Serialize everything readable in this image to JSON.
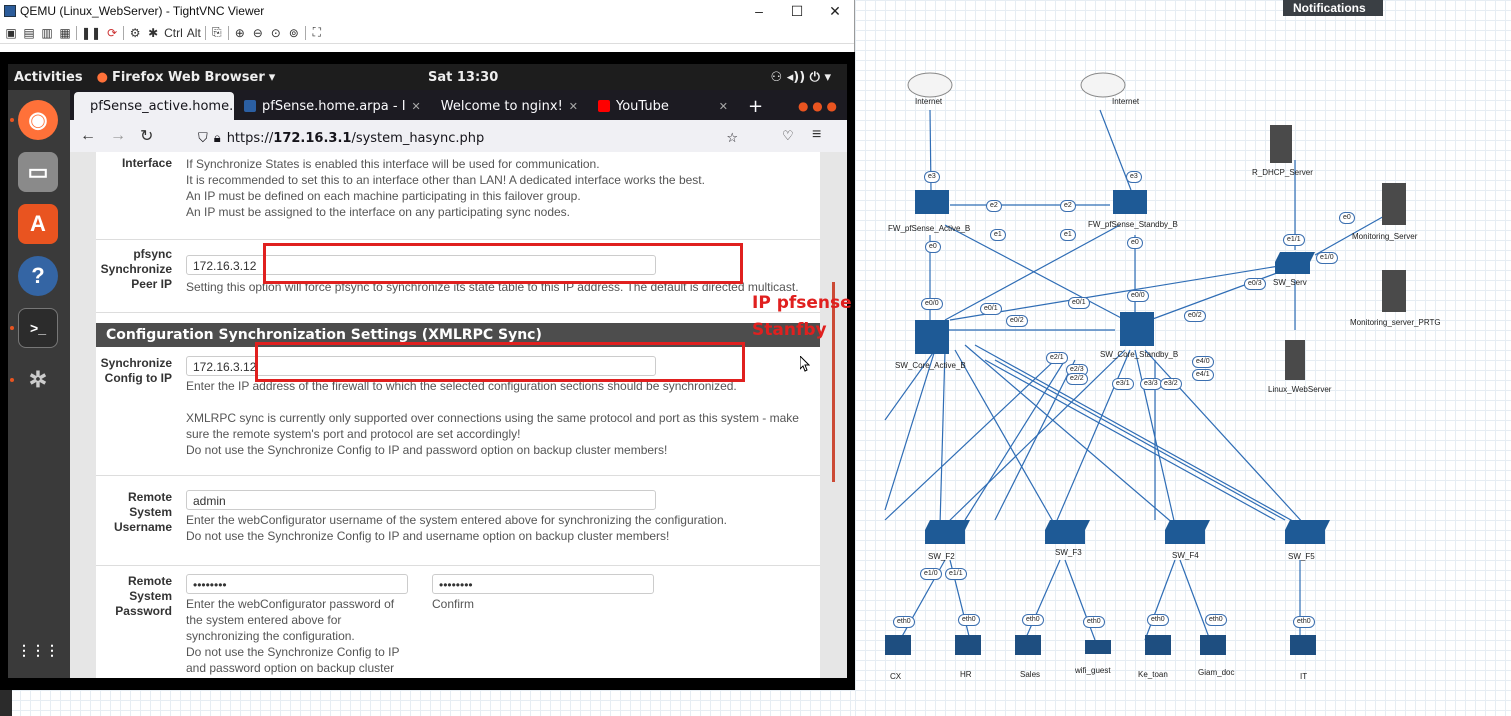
{
  "vnc": {
    "title": "QEMU (Linux_WebServer) - TightVNC Viewer",
    "toolbar": {
      "ctrl_label": "Ctrl",
      "alt_label": "Alt"
    }
  },
  "gnome": {
    "activities": "Activities",
    "app_name": "Firefox Web Browser",
    "clock": "Sat 13:30"
  },
  "firefox": {
    "tabs": [
      {
        "label": "pfSense_active.home.",
        "active": true
      },
      {
        "label": "pfSense.home.arpa - I",
        "active": false
      },
      {
        "label": "Welcome to nginx!",
        "active": false
      },
      {
        "label": "YouTube",
        "active": false
      }
    ],
    "url": {
      "scheme": "https://",
      "host": "172.16.3.1",
      "path": "/system_hasync.php"
    }
  },
  "pfsense": {
    "interface_label": "Interface",
    "interface_help": [
      "If Synchronize States is enabled this interface will be used for communication.",
      "It is recommended to set this to an interface other than LAN! A dedicated interface works the best.",
      "An IP must be defined on each machine participating in this failover group.",
      "An IP must be assigned to the interface on any participating sync nodes."
    ],
    "pfsync_label": "pfsync Synchronize Peer IP",
    "pfsync_value": "172.16.3.12",
    "pfsync_help": "Setting this option will force pfsync to synchronize its state table to this IP address. The default is directed multicast.",
    "section_title": "Configuration Synchronization Settings (XMLRPC Sync)",
    "sync_ip_label": "Synchronize Config to IP",
    "sync_ip_value": "172.16.3.12",
    "sync_ip_help1": "Enter the IP address of the firewall to which the selected configuration sections should be synchronized.",
    "sync_ip_help2": "XMLRPC sync is currently only supported over connections using the same protocol and port as this system - make sure the remote system's port and protocol are set accordingly!",
    "sync_ip_help3": "Do not use the Synchronize Config to IP and password option on backup cluster members!",
    "username_label": "Remote System Username",
    "username_value": "admin",
    "username_help1": "Enter the webConfigurator username of the system entered above for synchronizing the configuration.",
    "username_help2": "Do not use the Synchronize Config to IP and username option on backup cluster members!",
    "password_label": "Remote System Password",
    "password_value": "••••••••",
    "confirm_value": "••••••••",
    "password_help": "Enter the webConfigurator password of the system entered above for synchronizing the configuration.",
    "password_help2": "Do not use the Synchronize Config to IP and password option on backup cluster",
    "confirm_label": "Confirm"
  },
  "annotation": {
    "line1": "IP pfsense",
    "line2": "Stanfby"
  },
  "topology": {
    "notifications": "Notifications",
    "nodes": [
      {
        "id": "internet1",
        "label": "Internet"
      },
      {
        "id": "internet2",
        "label": "Internet"
      },
      {
        "id": "fw_active",
        "label": "FW_pfSense_Active_B"
      },
      {
        "id": "fw_standby",
        "label": "FW_pfSense_Standby_B"
      },
      {
        "id": "dhcp",
        "label": "R_DHCP_Server"
      },
      {
        "id": "monitoring",
        "label": "Monitoring_Server"
      },
      {
        "id": "sw_serv",
        "label": "SW_Serv"
      },
      {
        "id": "prtg",
        "label": "Monitoring_server_PRTG"
      },
      {
        "id": "core_active",
        "label": "SW_Core_Active_B"
      },
      {
        "id": "core_standby",
        "label": "SW_Core_Standby_B"
      },
      {
        "id": "linux_web",
        "label": "Linux_WebServer"
      },
      {
        "id": "sw_f2",
        "label": "SW_F2"
      },
      {
        "id": "sw_f3",
        "label": "SW_F3"
      },
      {
        "id": "sw_f4",
        "label": "SW_F4"
      },
      {
        "id": "sw_f5",
        "label": "SW_F5"
      },
      {
        "id": "cx",
        "label": "CX"
      },
      {
        "id": "hr",
        "label": "HR"
      },
      {
        "id": "sales",
        "label": "Sales"
      },
      {
        "id": "wifi",
        "label": "wifi_guest"
      },
      {
        "id": "ketoan",
        "label": "Ke_toan"
      },
      {
        "id": "giamdoc",
        "label": "Giam_doc"
      },
      {
        "id": "it",
        "label": "IT"
      }
    ],
    "ports": [
      "e3",
      "e3",
      "e2",
      "e2",
      "e1",
      "e1",
      "e0",
      "e0",
      "e0/0",
      "e0/0",
      "e0/1",
      "e0/1",
      "e0/2",
      "e0/2",
      "e0/3",
      "e1/0",
      "e1/1",
      "e0",
      "e1/0",
      "e1/1",
      "eth0",
      "eth0",
      "eth0",
      "eth0",
      "eth0",
      "eth0",
      "eth0",
      "e4/0",
      "e4/1",
      "e3/3",
      "e3/2",
      "e2/1",
      "e2/3",
      "e3/1",
      "e2/2"
    ]
  },
  "colors": {
    "red": "#e0201f",
    "link": "#2f6db5",
    "pf_section": "#4d4d4d"
  }
}
